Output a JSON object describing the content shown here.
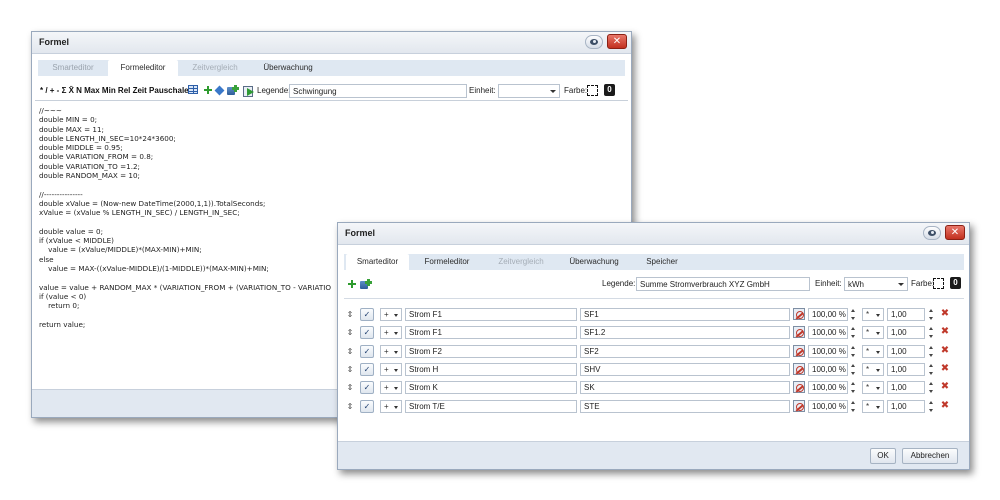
{
  "dialog1": {
    "title": "Formel",
    "tabs": [
      {
        "label": "Smarteditor",
        "state": "inactive-gray"
      },
      {
        "label": "Formeleditor",
        "state": "active"
      },
      {
        "label": "Zeitvergleich",
        "state": "disabled"
      },
      {
        "label": "Überwachung",
        "state": "normal"
      }
    ],
    "toolbar": {
      "operators": "* / + - Σ X̄ N Max Min Rel Zeit Pauschale",
      "legend_label": "Legende:",
      "legend_value": "Schwingung",
      "unit_label": "Einheit:",
      "unit_value": "",
      "color_label": "Farbe:",
      "zero_icon_text": "0"
    },
    "code_lines": [
      "//~~~",
      "double MIN = 0;",
      "double MAX = 11;",
      "double LENGTH_IN_SEC=10*24*3600;",
      "double MIDDLE = 0.95;",
      "double VARIATION_FROM = 0.8;",
      "double VARIATION_TO =1.2;",
      "double RANDOM_MAX = 10;",
      "",
      "//---------------",
      "double xValue = (Now-new DateTime(2000,1,1)).TotalSeconds;",
      "xValue = (xValue % LENGTH_IN_SEC) / LENGTH_IN_SEC;",
      "",
      "double value = 0;",
      "if (xValue < MIDDLE)",
      "    value = (xValue/MIDDLE)*(MAX-MIN)+MIN;",
      "else",
      "    value = MAX-((xValue-MIDDLE)/(1-MIDDLE))*(MAX-MIN)+MIN;",
      "",
      "value = value + RANDOM_MAX * (VARIATION_FROM + (VARIATION_TO - VARIATIO",
      "if (value < 0)",
      "    return 0;",
      "",
      "return value;"
    ]
  },
  "dialog2": {
    "title": "Formel",
    "tabs": [
      {
        "label": "Smarteditor",
        "state": "active"
      },
      {
        "label": "Formeleditor",
        "state": "normal"
      },
      {
        "label": "Zeitvergleich",
        "state": "disabled"
      },
      {
        "label": "Überwachung",
        "state": "normal"
      },
      {
        "label": "Speicher",
        "state": "normal"
      }
    ],
    "legend_label": "Legende:",
    "legend_value": "Summe Stromverbrauch XYZ GmbH",
    "unit_label": "Einheit:",
    "unit_value": "kWh",
    "color_label": "Farbe:",
    "zero_icon_text": "0",
    "rows": [
      {
        "handle": "⇕",
        "check": "✓",
        "operator": "+",
        "name": "Strom F1",
        "code": "SF1",
        "percent": "100,00 %",
        "mul": "*",
        "factor": "1,00"
      },
      {
        "handle": "⇕",
        "check": "✓",
        "operator": "+",
        "name": "Strom F1",
        "code": "SF1.2",
        "percent": "100,00 %",
        "mul": "*",
        "factor": "1,00"
      },
      {
        "handle": "⇕",
        "check": "✓",
        "operator": "+",
        "name": "Strom F2",
        "code": "SF2",
        "percent": "100,00 %",
        "mul": "*",
        "factor": "1,00"
      },
      {
        "handle": "⇕",
        "check": "✓",
        "operator": "+",
        "name": "Strom H",
        "code": "SHV",
        "percent": "100,00 %",
        "mul": "*",
        "factor": "1,00"
      },
      {
        "handle": "⇕",
        "check": "✓",
        "operator": "+",
        "name": "Strom K",
        "code": "SK",
        "percent": "100,00 %",
        "mul": "*",
        "factor": "1,00"
      },
      {
        "handle": "⇕",
        "check": "✓",
        "operator": "+",
        "name": "Strom T/E",
        "code": "STE",
        "percent": "100,00 %",
        "mul": "*",
        "factor": "1,00"
      }
    ],
    "buttons": {
      "ok": "OK",
      "cancel": "Abbrechen"
    }
  },
  "colors": {
    "title_bg": "#e2e7ee",
    "tab_bg": "#dfe8f2",
    "close_red": "#c1301f",
    "delete_red": "#c0392b",
    "add_green": "#2e9b2e"
  }
}
